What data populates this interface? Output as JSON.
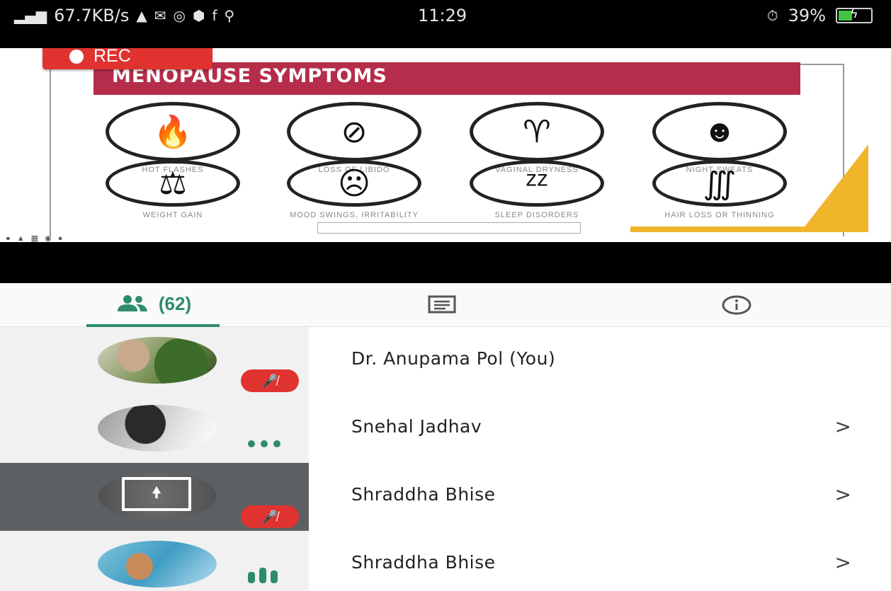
{
  "status_bar": {
    "signal": "📶",
    "speed": "67.7KB/s",
    "time": "11:29",
    "alarm": "⏱",
    "battery": "39%"
  },
  "rec": {
    "label": "REC"
  },
  "slide": {
    "title": "MENOPAUSE  SYMPTOMS",
    "symptoms": [
      {
        "label": "HOT FLASHES",
        "icon": "flame-icon"
      },
      {
        "label": "LOSS OF LIBIDO",
        "icon": "no-female-icon"
      },
      {
        "label": "VAGINAL DRYNESS",
        "icon": "uterus-icon"
      },
      {
        "label": "NIGHT SWEATS",
        "icon": "sweating-head-icon"
      },
      {
        "label": "WEIGHT GAIN",
        "icon": "scale-icon"
      },
      {
        "label": "MOOD SWINGS, IRRITABILITY",
        "icon": "face-icon"
      },
      {
        "label": "SLEEP DISORDERS",
        "icon": "no-sleep-icon"
      },
      {
        "label": "HAIR LOSS OR THINNING",
        "icon": "hair-icon"
      }
    ]
  },
  "tabs": {
    "participants_count": "(62)",
    "chat": "chat-icon",
    "info": "info-icon"
  },
  "participants": [
    {
      "name": "Dr. Anupama Pol (You)",
      "chevron": ""
    },
    {
      "name": "Snehal Jadhav",
      "chevron": ">"
    },
    {
      "name": "Shraddha Bhise",
      "chevron": ">"
    },
    {
      "name": "Shraddha Bhise",
      "chevron": ">"
    }
  ],
  "colors": {
    "accent": "#2e8b6e",
    "rec": "#e0332f",
    "slide_title": "#b52d4a",
    "active_row": "#5d6063"
  }
}
